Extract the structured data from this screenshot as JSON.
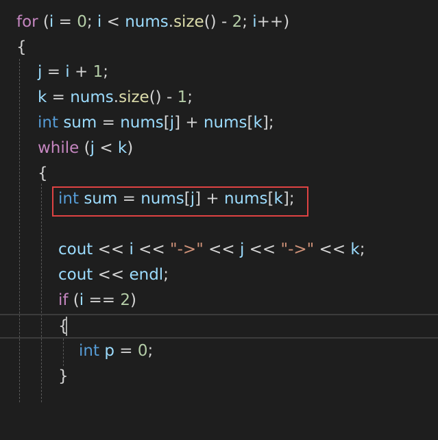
{
  "editor": {
    "lines": {
      "l1": {
        "t1": "for",
        "t2": " (",
        "t3": "i",
        "t4": " = ",
        "t5": "0",
        "t6": "; ",
        "t7": "i",
        "t8": " < ",
        "t9": "nums",
        "t10": ".",
        "t11": "size",
        "t12": "() - ",
        "t13": "2",
        "t14": "; ",
        "t15": "i",
        "t16": "++)"
      },
      "l2": {
        "t1": "{"
      },
      "l3": {
        "t1": "j",
        "t2": " = ",
        "t3": "i",
        "t4": " + ",
        "t5": "1",
        "t6": ";"
      },
      "l4": {
        "t1": "k",
        "t2": " = ",
        "t3": "nums",
        "t4": ".",
        "t5": "size",
        "t6": "() - ",
        "t7": "1",
        "t8": ";"
      },
      "l5": {
        "t1": "int",
        "t2": " ",
        "t3": "sum",
        "t4": " = ",
        "t5": "nums",
        "t6": "[",
        "t7": "j",
        "t8": "] + ",
        "t9": "nums",
        "t10": "[",
        "t11": "k",
        "t12": "];"
      },
      "l6": {
        "t1": "while",
        "t2": " (",
        "t3": "j",
        "t4": " < ",
        "t5": "k",
        "t6": ")"
      },
      "l7": {
        "t1": "{"
      },
      "l8": {
        "t1": "int",
        "t2": " ",
        "t3": "sum",
        "t4": " = ",
        "t5": "nums",
        "t6": "[",
        "t7": "j",
        "t8": "] + ",
        "t9": "nums",
        "t10": "[",
        "t11": "k",
        "t12": "];"
      },
      "l9": {},
      "l10": {
        "t1": "cout",
        "t2": " << ",
        "t3": "i",
        "t4": " << ",
        "t5": "\"->\"",
        "t6": " << ",
        "t7": "j",
        "t8": " << ",
        "t9": "\"->\"",
        "t10": " << ",
        "t11": "k",
        "t12": ";"
      },
      "l11": {
        "t1": "cout",
        "t2": " << ",
        "t3": "endl",
        "t4": ";"
      },
      "l12": {
        "t1": "if",
        "t2": " (",
        "t3": "i",
        "t4": " == ",
        "t5": "2",
        "t6": ")"
      },
      "l13": {
        "t1": "{"
      },
      "l14": {
        "t1": "int",
        "t2": " ",
        "t3": "p",
        "t4": " = ",
        "t5": "0",
        "t6": ";"
      },
      "l15": {
        "t1": "}"
      }
    }
  },
  "colors": {
    "background": "#1e1e1e",
    "keyword": "#569cd6",
    "control": "#c586c0",
    "variable": "#9cdcfe",
    "function": "#dcdcaa",
    "number": "#b5cea8",
    "string": "#ce9178",
    "highlight_border": "#e04343"
  }
}
